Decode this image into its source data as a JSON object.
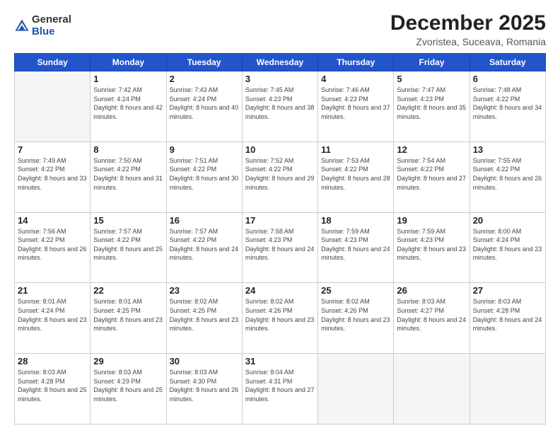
{
  "logo": {
    "general": "General",
    "blue": "Blue"
  },
  "title": "December 2025",
  "subtitle": "Zvoristea, Suceava, Romania",
  "header_days": [
    "Sunday",
    "Monday",
    "Tuesday",
    "Wednesday",
    "Thursday",
    "Friday",
    "Saturday"
  ],
  "weeks": [
    [
      {
        "day": "",
        "sunrise": "",
        "sunset": "",
        "daylight": "",
        "empty": true
      },
      {
        "day": "1",
        "sunrise": "Sunrise: 7:42 AM",
        "sunset": "Sunset: 4:24 PM",
        "daylight": "Daylight: 8 hours and 42 minutes."
      },
      {
        "day": "2",
        "sunrise": "Sunrise: 7:43 AM",
        "sunset": "Sunset: 4:24 PM",
        "daylight": "Daylight: 8 hours and 40 minutes."
      },
      {
        "day": "3",
        "sunrise": "Sunrise: 7:45 AM",
        "sunset": "Sunset: 4:23 PM",
        "daylight": "Daylight: 8 hours and 38 minutes."
      },
      {
        "day": "4",
        "sunrise": "Sunrise: 7:46 AM",
        "sunset": "Sunset: 4:23 PM",
        "daylight": "Daylight: 8 hours and 37 minutes."
      },
      {
        "day": "5",
        "sunrise": "Sunrise: 7:47 AM",
        "sunset": "Sunset: 4:23 PM",
        "daylight": "Daylight: 8 hours and 35 minutes."
      },
      {
        "day": "6",
        "sunrise": "Sunrise: 7:48 AM",
        "sunset": "Sunset: 4:22 PM",
        "daylight": "Daylight: 8 hours and 34 minutes."
      }
    ],
    [
      {
        "day": "7",
        "sunrise": "Sunrise: 7:49 AM",
        "sunset": "Sunset: 4:22 PM",
        "daylight": "Daylight: 8 hours and 33 minutes."
      },
      {
        "day": "8",
        "sunrise": "Sunrise: 7:50 AM",
        "sunset": "Sunset: 4:22 PM",
        "daylight": "Daylight: 8 hours and 31 minutes."
      },
      {
        "day": "9",
        "sunrise": "Sunrise: 7:51 AM",
        "sunset": "Sunset: 4:22 PM",
        "daylight": "Daylight: 8 hours and 30 minutes."
      },
      {
        "day": "10",
        "sunrise": "Sunrise: 7:52 AM",
        "sunset": "Sunset: 4:22 PM",
        "daylight": "Daylight: 8 hours and 29 minutes."
      },
      {
        "day": "11",
        "sunrise": "Sunrise: 7:53 AM",
        "sunset": "Sunset: 4:22 PM",
        "daylight": "Daylight: 8 hours and 28 minutes."
      },
      {
        "day": "12",
        "sunrise": "Sunrise: 7:54 AM",
        "sunset": "Sunset: 4:22 PM",
        "daylight": "Daylight: 8 hours and 27 minutes."
      },
      {
        "day": "13",
        "sunrise": "Sunrise: 7:55 AM",
        "sunset": "Sunset: 4:22 PM",
        "daylight": "Daylight: 8 hours and 26 minutes."
      }
    ],
    [
      {
        "day": "14",
        "sunrise": "Sunrise: 7:56 AM",
        "sunset": "Sunset: 4:22 PM",
        "daylight": "Daylight: 8 hours and 26 minutes."
      },
      {
        "day": "15",
        "sunrise": "Sunrise: 7:57 AM",
        "sunset": "Sunset: 4:22 PM",
        "daylight": "Daylight: 8 hours and 25 minutes."
      },
      {
        "day": "16",
        "sunrise": "Sunrise: 7:57 AM",
        "sunset": "Sunset: 4:22 PM",
        "daylight": "Daylight: 8 hours and 24 minutes."
      },
      {
        "day": "17",
        "sunrise": "Sunrise: 7:58 AM",
        "sunset": "Sunset: 4:23 PM",
        "daylight": "Daylight: 8 hours and 24 minutes."
      },
      {
        "day": "18",
        "sunrise": "Sunrise: 7:59 AM",
        "sunset": "Sunset: 4:23 PM",
        "daylight": "Daylight: 8 hours and 24 minutes."
      },
      {
        "day": "19",
        "sunrise": "Sunrise: 7:59 AM",
        "sunset": "Sunset: 4:23 PM",
        "daylight": "Daylight: 8 hours and 23 minutes."
      },
      {
        "day": "20",
        "sunrise": "Sunrise: 8:00 AM",
        "sunset": "Sunset: 4:24 PM",
        "daylight": "Daylight: 8 hours and 23 minutes."
      }
    ],
    [
      {
        "day": "21",
        "sunrise": "Sunrise: 8:01 AM",
        "sunset": "Sunset: 4:24 PM",
        "daylight": "Daylight: 8 hours and 23 minutes."
      },
      {
        "day": "22",
        "sunrise": "Sunrise: 8:01 AM",
        "sunset": "Sunset: 4:25 PM",
        "daylight": "Daylight: 8 hours and 23 minutes."
      },
      {
        "day": "23",
        "sunrise": "Sunrise: 8:02 AM",
        "sunset": "Sunset: 4:25 PM",
        "daylight": "Daylight: 8 hours and 23 minutes."
      },
      {
        "day": "24",
        "sunrise": "Sunrise: 8:02 AM",
        "sunset": "Sunset: 4:26 PM",
        "daylight": "Daylight: 8 hours and 23 minutes."
      },
      {
        "day": "25",
        "sunrise": "Sunrise: 8:02 AM",
        "sunset": "Sunset: 4:26 PM",
        "daylight": "Daylight: 8 hours and 23 minutes."
      },
      {
        "day": "26",
        "sunrise": "Sunrise: 8:03 AM",
        "sunset": "Sunset: 4:27 PM",
        "daylight": "Daylight: 8 hours and 24 minutes."
      },
      {
        "day": "27",
        "sunrise": "Sunrise: 8:03 AM",
        "sunset": "Sunset: 4:28 PM",
        "daylight": "Daylight: 8 hours and 24 minutes."
      }
    ],
    [
      {
        "day": "28",
        "sunrise": "Sunrise: 8:03 AM",
        "sunset": "Sunset: 4:28 PM",
        "daylight": "Daylight: 8 hours and 25 minutes."
      },
      {
        "day": "29",
        "sunrise": "Sunrise: 8:03 AM",
        "sunset": "Sunset: 4:29 PM",
        "daylight": "Daylight: 8 hours and 25 minutes."
      },
      {
        "day": "30",
        "sunrise": "Sunrise: 8:03 AM",
        "sunset": "Sunset: 4:30 PM",
        "daylight": "Daylight: 8 hours and 26 minutes."
      },
      {
        "day": "31",
        "sunrise": "Sunrise: 8:04 AM",
        "sunset": "Sunset: 4:31 PM",
        "daylight": "Daylight: 8 hours and 27 minutes."
      },
      {
        "day": "",
        "sunrise": "",
        "sunset": "",
        "daylight": "",
        "empty": true
      },
      {
        "day": "",
        "sunrise": "",
        "sunset": "",
        "daylight": "",
        "empty": true
      },
      {
        "day": "",
        "sunrise": "",
        "sunset": "",
        "daylight": "",
        "empty": true
      }
    ]
  ]
}
